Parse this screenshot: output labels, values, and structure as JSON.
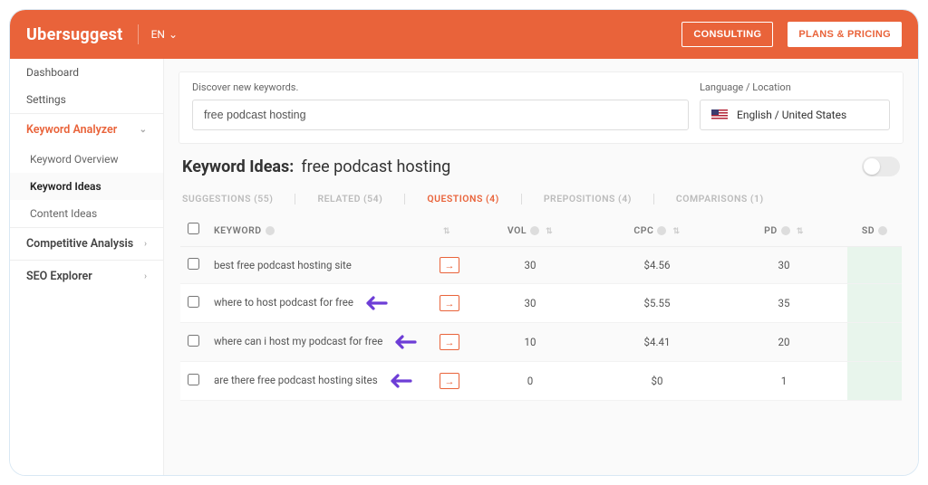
{
  "header": {
    "brand": "Ubersuggest",
    "lang": "EN",
    "consult": "CONSULTING",
    "plans": "PLANS & PRICING"
  },
  "sidebar": {
    "top": [
      "Dashboard",
      "Settings"
    ],
    "sections": [
      {
        "label": "Keyword Analyzer",
        "active": true,
        "items": [
          "Keyword Overview",
          "Keyword Ideas",
          "Content Ideas"
        ],
        "selected": 1
      },
      {
        "label": "Competitive Analysis",
        "active": false,
        "items": []
      },
      {
        "label": "SEO Explorer",
        "active": false,
        "items": []
      }
    ]
  },
  "discover": {
    "label": "Discover new keywords.",
    "value": "free podcast hosting",
    "loc_label": "Language / Location",
    "loc_value": "English / United States"
  },
  "ideas": {
    "title": "Keyword Ideas:",
    "keyword": "free podcast hosting"
  },
  "subtabs": [
    {
      "label": "SUGGESTIONS (55)",
      "active": false
    },
    {
      "label": "RELATED (54)",
      "active": false
    },
    {
      "label": "QUESTIONS (4)",
      "active": true
    },
    {
      "label": "PREPOSITIONS (4)",
      "active": false
    },
    {
      "label": "COMPARISONS (1)",
      "active": false
    }
  ],
  "columns": {
    "keyword": "KEYWORD",
    "vol": "VOL",
    "cpc": "CPC",
    "pd": "PD",
    "sd": "SD"
  },
  "chart_data": {
    "type": "table",
    "columns": [
      "keyword",
      "vol",
      "cpc",
      "pd",
      "sd"
    ],
    "rows": [
      {
        "keyword": "best free podcast hosting site",
        "vol": 30,
        "cpc": "$4.56",
        "pd": 30,
        "sd": "",
        "arrow": false
      },
      {
        "keyword": "where to host podcast for free",
        "vol": 30,
        "cpc": "$5.55",
        "pd": 35,
        "sd": "",
        "arrow": true
      },
      {
        "keyword": "where can i host my podcast for free",
        "vol": 10,
        "cpc": "$4.41",
        "pd": 20,
        "sd": "",
        "arrow": true
      },
      {
        "keyword": "are there free podcast hosting sites",
        "vol": 0,
        "cpc": "$0",
        "pd": 1,
        "sd": "",
        "arrow": true
      }
    ]
  }
}
